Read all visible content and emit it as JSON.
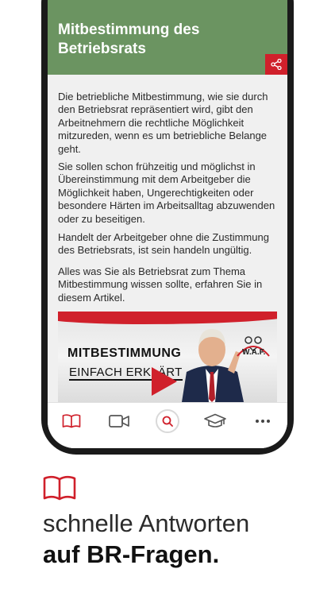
{
  "article": {
    "title": "Mitbestimmung des Betriebsrats",
    "paragraphs": [
      "Die betriebliche Mitbestimmung, wie sie durch den Betriebsrat repräsentiert wird, gibt den Arbeitnehmern die rechtliche Möglichkeit mitzureden, wenn es um betriebliche Belange geht.",
      "Sie sollen schon frühzeitig und möglichst in Übereinstimmung mit dem Arbeitgeber die Möglichkeit haben, Ungerechtigkeiten oder besondere Härten im Arbeitsalltag abzuwenden oder zu beseitigen.",
      "Handelt der Arbeitgeber ohne die Zustimmung des Betriebsrats, ist sein handeln ungültig.",
      "Alles was Sie als Betriebsrat zum Thema Mitbestimmung wissen sollte, erfahren Sie in diesem Artikel."
    ],
    "share_icon": "share-icon"
  },
  "video": {
    "line1": "MITBESTIMMUNG",
    "line2": "EINFACH ERKLÄRT",
    "logo": "W.A.F.",
    "play_icon": "play-icon"
  },
  "tabbar": {
    "items": [
      {
        "icon": "book-icon",
        "active": true
      },
      {
        "icon": "video-icon",
        "active": false
      },
      {
        "icon": "search-icon",
        "active": false
      },
      {
        "icon": "graduation-cap-icon",
        "active": false
      },
      {
        "icon": "more-icon",
        "active": false
      }
    ]
  },
  "caption": {
    "icon": "book-icon",
    "line1": "schnelle Antworten",
    "line2": "auf BR-Fragen."
  },
  "colors": {
    "header_green": "#6b9461",
    "accent_red": "#d0202b",
    "content_bg": "#f0f0f0"
  }
}
